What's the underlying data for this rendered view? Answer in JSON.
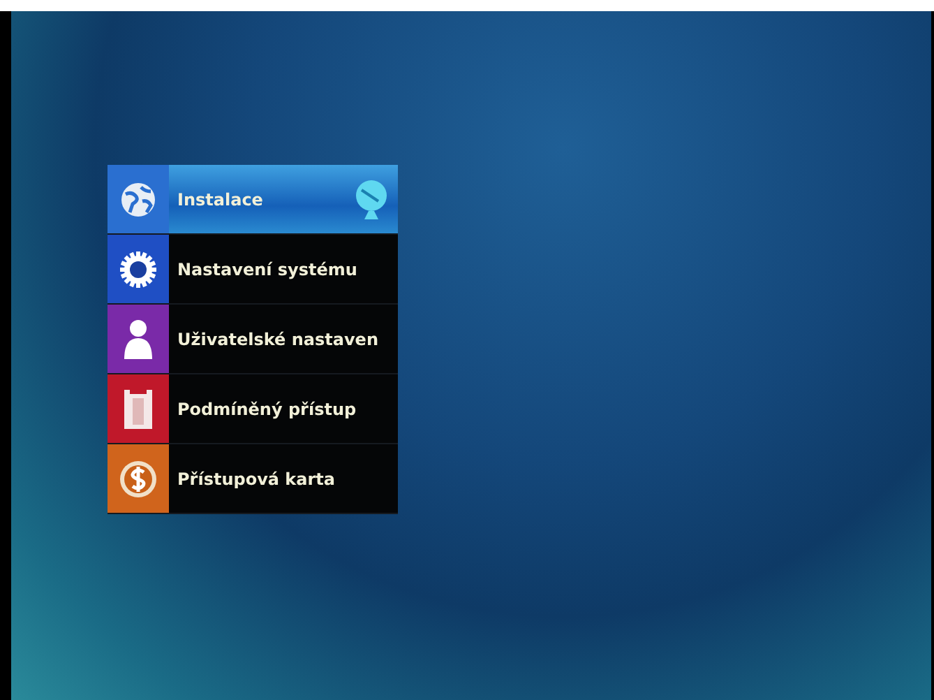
{
  "menu": {
    "items": [
      {
        "label": "Instalace",
        "kind": "globe",
        "color": "#2a6fd0",
        "selected": true
      },
      {
        "label": "Nastavení systému",
        "kind": "gear",
        "color": "#1f4fc4",
        "selected": false
      },
      {
        "label": "Uživatelské nastaven",
        "kind": "person",
        "color": "#7a2aa8",
        "selected": false
      },
      {
        "label": "Podmíněný přístup",
        "kind": "slot",
        "color": "#c0182a",
        "selected": false
      },
      {
        "label": "Přístupová karta",
        "kind": "coin",
        "color": "#d0641c",
        "selected": false
      }
    ]
  }
}
